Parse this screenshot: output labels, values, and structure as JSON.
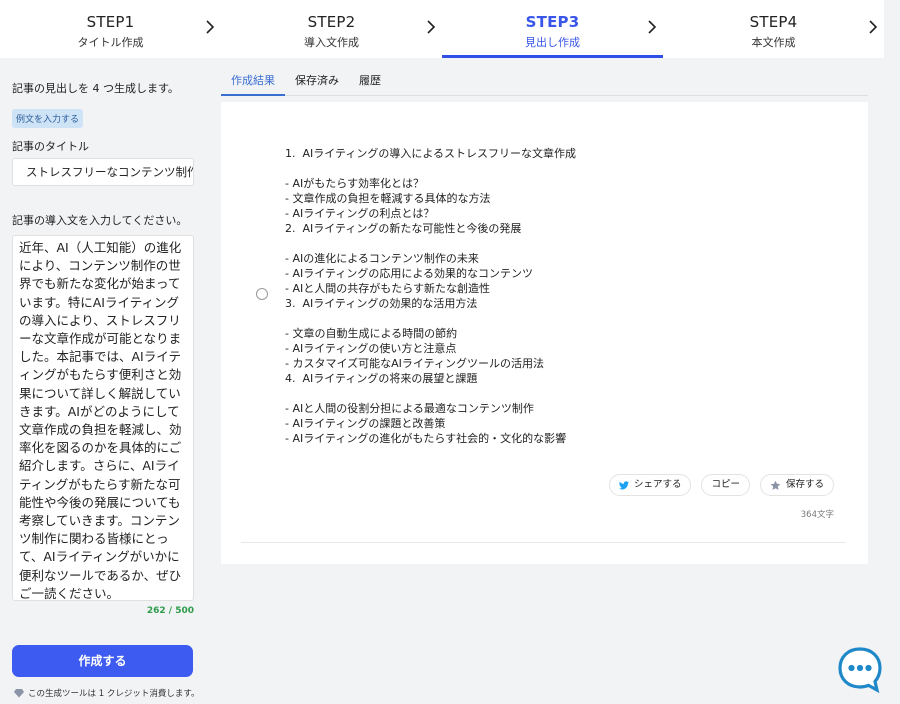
{
  "steps": [
    {
      "num": "STEP1",
      "name": "タイトル作成"
    },
    {
      "num": "STEP2",
      "name": "導入文作成"
    },
    {
      "num": "STEP3",
      "name": "見出し作成"
    },
    {
      "num": "STEP4",
      "name": "本文作成"
    }
  ],
  "left": {
    "intro": "記事の見出しを 4 つ生成します。",
    "example_badge": "例文を入力する",
    "title_label": "記事のタイトル",
    "title_value": "ストレスフリーなコンテンツ制作",
    "intro_label": "記事の導入文を入力してください。",
    "intro_value": " 近年、AI（人工知能）の進化により、コンテンツ制作の世界でも新たな変化が始まっています。特にAIライティングの導入により、ストレスフリーな文章作成が可能となりました。本記事では、AIライティングがもたらす便利さと効果について詳しく解説していきます。AIがどのようにして文章作成の負担を軽減し、効率化を図るのかを具体的にご紹介します。さらに、AIライティングがもたらす新たな可能性や今後の発展についても考察していきます。コンテンツ制作に関わる皆様にとって、AIライティングがいかに便利なツールであるか、ぜひご一読ください。",
    "count": "262 / 500",
    "create_button": "作成する",
    "credit_note": "この生成ツールは 1 クレジット消費します。"
  },
  "tabs": [
    "作成結果",
    "保存済み",
    "履歴"
  ],
  "result": {
    "text": "1.  AIライティングの導入によるストレスフリーな文章作成\n\n- AIがもたらす効率化とは？\n- 文章作成の負担を軽減する具体的な方法\n- AIライティングの利点とは？\n2.  AIライティングの新たな可能性と今後の発展\n\n- AIの進化によるコンテンツ制作の未来\n- AIライティングの応用による効果的なコンテンツ\n- AIと人間の共存がもたらす新たな創造性\n3.  AIライティングの効果的な活用方法\n\n- 文章の自動生成による時間の節約\n- AIライティングの使い方と注意点\n- カスタマイズ可能なAIライティングツールの活用法\n4.  AIライティングの将来の展望と課題\n\n- AIと人間の役割分担による最適なコンテンツ制作\n- AIライティングの課題と改善策\n- AIライティングの進化がもたらす社会的・文化的な影響",
    "share_button": "シェアする",
    "copy_button": "コピー",
    "save_button": "保存する",
    "char_count": "364文字"
  },
  "colors": {
    "accent": "#3d5af1",
    "active_step": "#3a56e8",
    "tab_active": "#3a6fd1",
    "count_green": "#2e9a4a",
    "twitter": "#1da1f2",
    "chat": "#1e88c9"
  },
  "icons": {
    "step_separator": "chevron-right-icon",
    "share": "twitter-icon",
    "save": "star-icon",
    "credit": "diamond-icon",
    "chat": "chat-bubble-icon"
  }
}
